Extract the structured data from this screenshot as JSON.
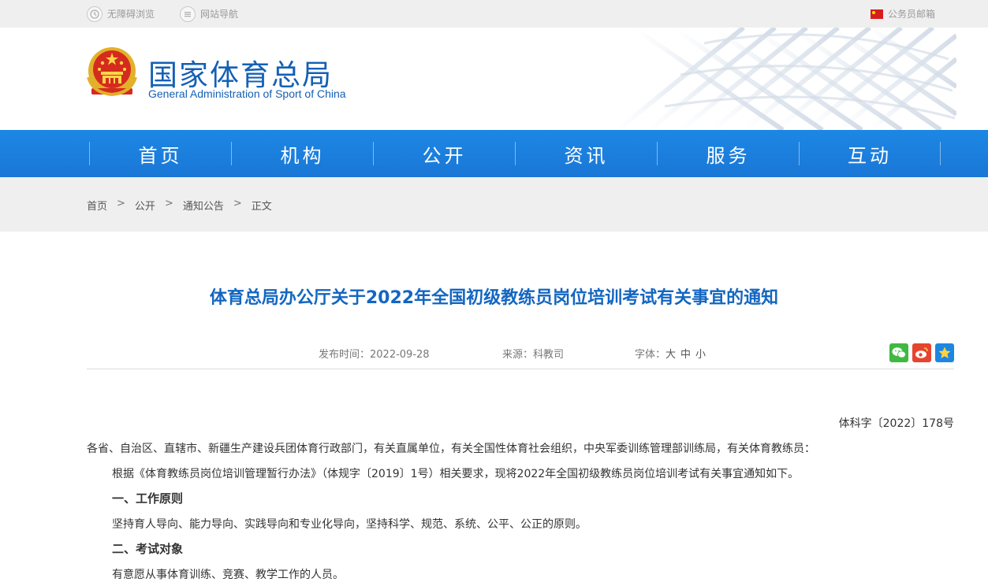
{
  "topbar": {
    "accessibility": "无障碍浏览",
    "sitemap": "网站导航",
    "mail": "公务员邮箱"
  },
  "header": {
    "title": "国家体育总局",
    "subtitle": "General Administration of Sport of China"
  },
  "nav": {
    "items": [
      "首页",
      "机构",
      "公开",
      "资讯",
      "服务",
      "互动"
    ]
  },
  "breadcrumb": {
    "items": [
      "首页",
      "公开",
      "通知公告",
      "正文"
    ],
    "separator": ">"
  },
  "article": {
    "title": "体育总局办公厅关于2022年全国初级教练员岗位培训考试有关事宜的通知",
    "publish_label": "发布时间：",
    "publish_date": "2022-09-28",
    "source_label": "来源：",
    "source": "科教司",
    "font_label": "字体：",
    "font_sizes": [
      "大",
      "中",
      "小"
    ],
    "doc_number": "体科字〔2022〕178号",
    "recipients": "各省、自治区、直辖市、新疆生产建设兵团体育行政部门，有关直属单位，有关全国性体育社会组织，中央军委训练管理部训练局，有关体育教练员：",
    "intro": "根据《体育教练员岗位培训管理暂行办法》（体规字〔2019〕1号）相关要求，现将2022年全国初级教练员岗位培训考试有关事宜通知如下。",
    "section1_heading": "一、工作原则",
    "section1_text": "坚持育人导向、能力导向、实践导向和专业化导向，坚持科学、规范、系统、公平、公正的原则。",
    "section2_heading": "二、考试对象",
    "section2_text": "有意愿从事体育训练、竞赛、教学工作的人员。"
  },
  "share": {
    "icons": [
      "wechat-icon",
      "weibo-icon",
      "favorite-icon"
    ]
  },
  "colors": {
    "brand_blue": "#1460b5",
    "nav_blue": "#1a7ad8",
    "title_blue": "#1366c1",
    "wechat_green": "#3fb93f",
    "weibo_red": "#e6442f",
    "favorite_blue": "#1f86e0"
  }
}
